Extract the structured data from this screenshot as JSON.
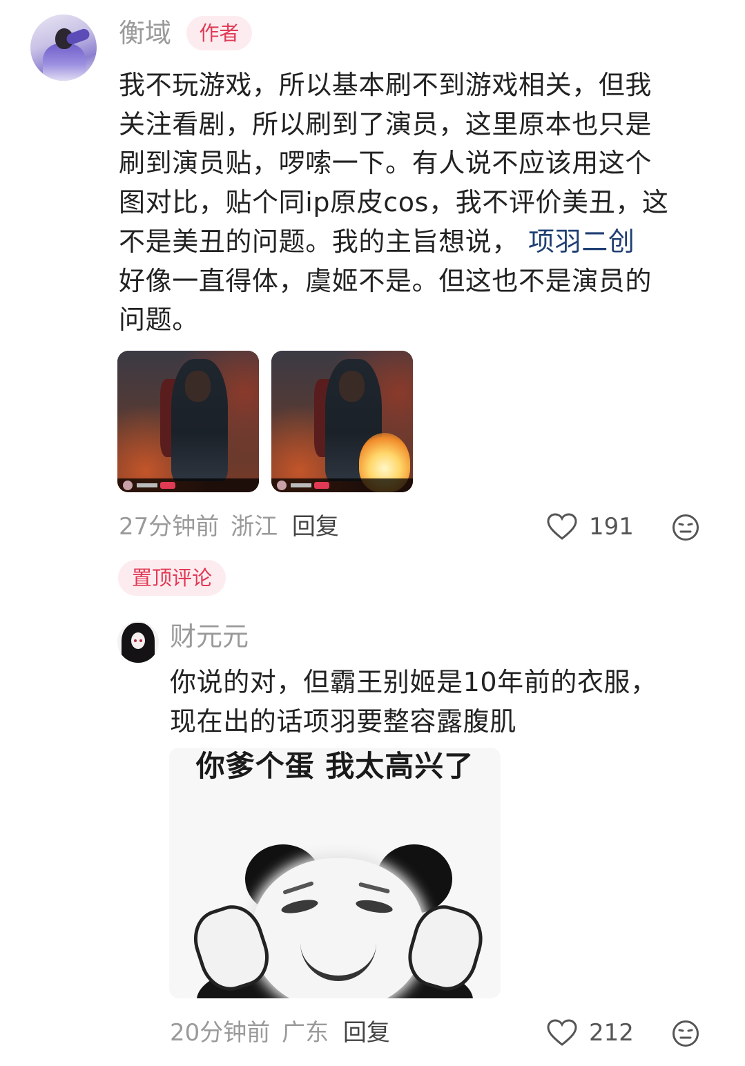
{
  "comment": {
    "username": "衡域",
    "author_badge": "作者",
    "lines": [
      "我不玩游戏，所以基本刷不到游戏相关，但我",
      "关注看剧，所以刷到了演员，这里原本也只是",
      "刷到演员贴，啰嗦一下。有人说不应该用这个",
      "图对比，贴个同ip原皮cos，我不评价美丑，这",
      "不是美丑的问题。我的主旨想说，"
    ],
    "link_text": "项羽二创",
    "lines_after": [
      "好像一直得体，虞姬不是。但这也不是演员的",
      "问题。"
    ],
    "time": "27分钟前",
    "location": "浙江",
    "reply_label": "回复",
    "likes": "191"
  },
  "pinned_label": "置顶评论",
  "reply": {
    "username": "财元元",
    "lines": [
      "你说的对，但霸王别姬是10年前的衣服，",
      "现在出的话项羽要整容露腹肌"
    ],
    "meme_caption": "你爹个蛋 我太高兴了",
    "time": "20分钟前",
    "location": "广东",
    "reply_label": "回复",
    "likes": "212"
  },
  "colors": {
    "badge_bg": "#fdecef",
    "badge_text": "#e03a55",
    "link": "#1f3f73",
    "muted": "#9a9a9a"
  },
  "icons": [
    "heart-icon",
    "neutral-face-icon"
  ]
}
